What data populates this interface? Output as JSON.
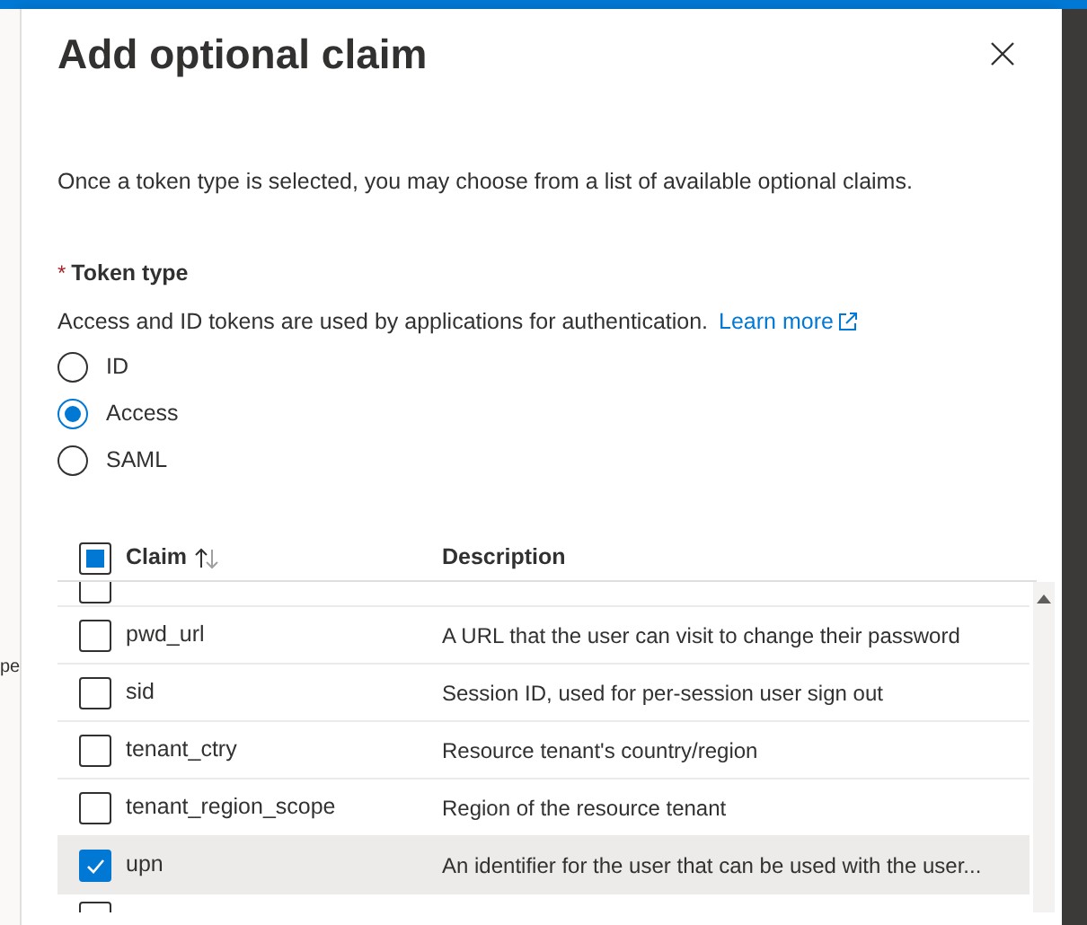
{
  "background": {
    "text": "pe"
  },
  "panel": {
    "title": "Add optional claim",
    "intro": "Once a token type is selected, you may choose from a list of available optional claims."
  },
  "token_type": {
    "label": "Token type",
    "required_mark": "*",
    "help": "Access and ID tokens are used by applications for authentication.",
    "link": "Learn more",
    "options": [
      {
        "label": "ID",
        "selected": false
      },
      {
        "label": "Access",
        "selected": true
      },
      {
        "label": "SAML",
        "selected": false
      }
    ]
  },
  "table": {
    "select_all_indeterminate": true,
    "columns": [
      "Claim",
      "Description"
    ],
    "cut_rows": [
      {
        "checked": false
      },
      {
        "checked": false
      }
    ],
    "rows": [
      {
        "claim": "pwd_url",
        "description": "A URL that the user can visit to change their password",
        "checked": false
      },
      {
        "claim": "sid",
        "description": "Session ID, used for per-session user sign out",
        "checked": false
      },
      {
        "claim": "tenant_ctry",
        "description": "Resource tenant's country/region",
        "checked": false
      },
      {
        "claim": "tenant_region_scope",
        "description": "Region of the resource tenant",
        "checked": false
      },
      {
        "claim": "upn",
        "description": "An identifier for the user that can be used with the user...",
        "checked": true
      }
    ]
  }
}
